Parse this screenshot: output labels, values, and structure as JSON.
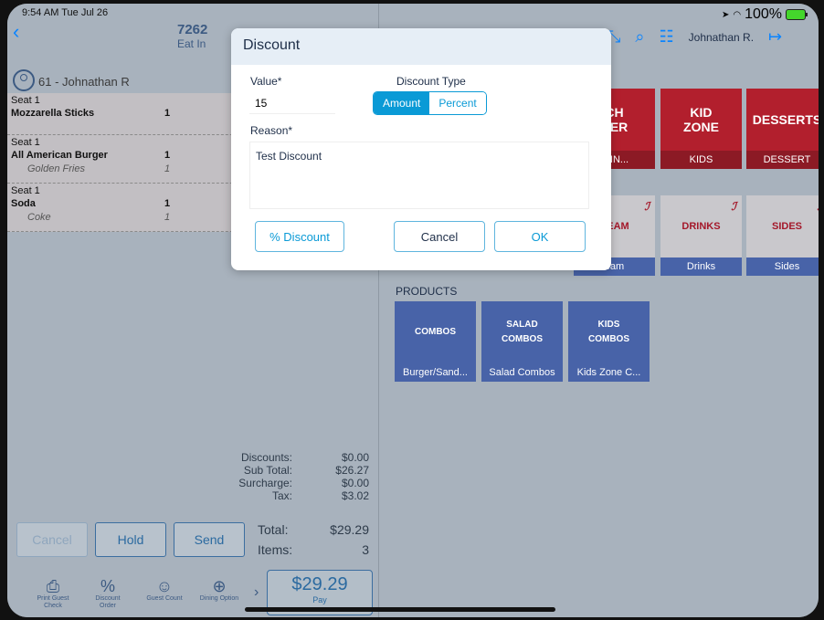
{
  "status_bar": {
    "time": "9:54 AM  Tue Jul 26",
    "battery": "100%"
  },
  "order": {
    "number": "7262",
    "type": "Eat In",
    "customer": "61 - Johnathan R"
  },
  "items": [
    {
      "seat": "Seat 1",
      "name": "Mozzarella Sticks",
      "qty": "1"
    },
    {
      "seat": "Seat 1",
      "name": "All American Burger",
      "qty": "1",
      "modifier": "Golden Fries",
      "mod_qty": "1"
    },
    {
      "seat": "Seat 1",
      "name": "Soda",
      "qty": "1",
      "modifier": "Coke",
      "mod_qty": "1"
    }
  ],
  "totals": {
    "discounts_label": "Discounts:",
    "discounts": "$0.00",
    "subtotal_label": "Sub Total:",
    "subtotal": "$26.27",
    "surcharge_label": "Surcharge:",
    "surcharge": "$0.00",
    "tax_label": "Tax:",
    "tax": "$3.02",
    "total_label": "Total:",
    "total": "$29.29",
    "items_label": "Items:",
    "items": "3"
  },
  "actions": {
    "cancel": "Cancel",
    "hold": "Hold",
    "send": "Send"
  },
  "toolbar": {
    "print": "Print Guest Check",
    "discount": "Discount Order",
    "guest": "Guest Count",
    "dining": "Dining Option"
  },
  "pay": {
    "amount": "$29.29",
    "label": "Pay"
  },
  "header": {
    "user": "Johnathan R."
  },
  "menu_tiles": [
    {
      "title": "CH\nNER",
      "caption": "/DIN..."
    },
    {
      "title": "KID\nZONE",
      "caption": "KIDS"
    },
    {
      "title": "DESSERTS",
      "caption": "DESSERT"
    },
    {
      "title": "REAM",
      "caption": "eam"
    },
    {
      "title": "DRINKS",
      "caption": "Drinks"
    },
    {
      "title": "SIDES",
      "caption": "Sides"
    }
  ],
  "products_label": "PRODUCTS",
  "product_tiles": [
    {
      "title": "COMBOS",
      "caption": "Burger/Sand..."
    },
    {
      "title": "SALAD\nCOMBOS",
      "caption": "Salad Combos"
    },
    {
      "title": "KIDS\nCOMBOS",
      "caption": "Kids Zone C..."
    }
  ],
  "dialog": {
    "title": "Discount",
    "value_label": "Value*",
    "value": "15",
    "type_label": "Discount Type",
    "type_options": [
      "Amount",
      "Percent"
    ],
    "type_selected": "Amount",
    "reason_label": "Reason*",
    "reason": "Test Discount",
    "percent_button": "% Discount",
    "cancel_button": "Cancel",
    "ok_button": "OK"
  },
  "colors": {
    "accent": "#0a9ad6",
    "ios_blue": "#0a84ff",
    "menu_red": "#b21f2d",
    "menu_blue": "#4863a8"
  }
}
